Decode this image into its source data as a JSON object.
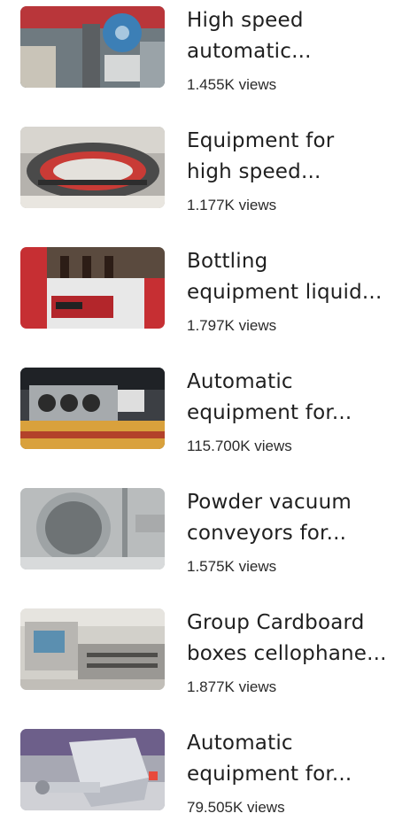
{
  "videos": [
    {
      "title": "High speed\nautomatic...",
      "views": "1.455K views",
      "thumbnail": "packaging-machine-blue-film"
    },
    {
      "title": "Equipment for\nhigh speed...",
      "views": "1.177K views",
      "thumbnail": "rotary-filling-machine"
    },
    {
      "title": "Bottling\nequipment liquid...",
      "views": "1.797K views",
      "thumbnail": "bottling-machine-red-panel"
    },
    {
      "title": "Automatic\nequipment for...",
      "views": "115.700K views",
      "thumbnail": "sealing-machine-fans"
    },
    {
      "title": "Powder vacuum\nconveyors for...",
      "views": "1.575K views",
      "thumbnail": "vacuum-conveyor-hopper"
    },
    {
      "title": "Group Cardboard\nboxes cellophane...",
      "views": "1.877K views",
      "thumbnail": "cellophane-wrapping-machine"
    },
    {
      "title": "Automatic\nequipment for...",
      "views": "79.505K views",
      "thumbnail": "steel-mixer-hopper"
    }
  ]
}
